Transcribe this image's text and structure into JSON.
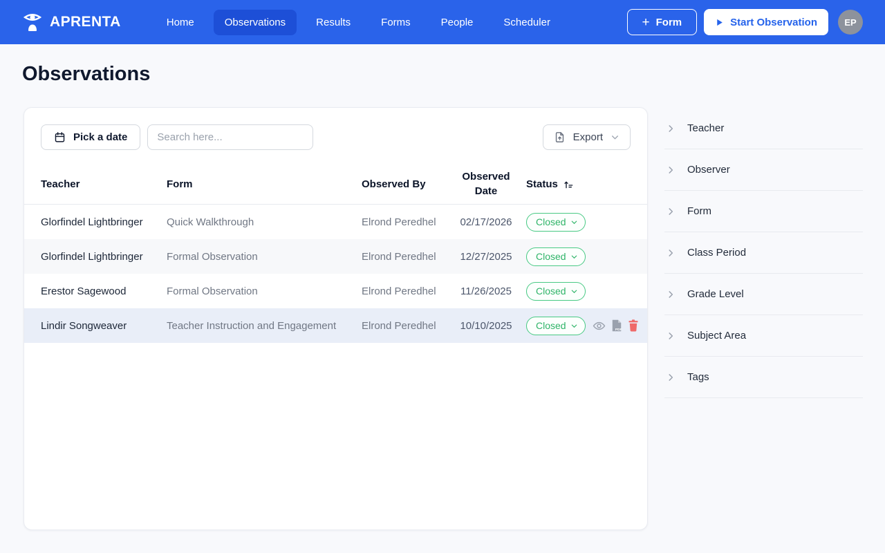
{
  "colors": {
    "navbar_blue": "#2a63ea",
    "nav_active_blue": "#1d4fd7",
    "accent_blue": "#2563eb",
    "badge_green_text": "#2fb468",
    "badge_green_border": "#47c983",
    "trash_red": "#ef6a6a",
    "row_highlight": "#e9eef8",
    "avatar_gray": "#8d929c"
  },
  "navbar": {
    "brand": "APRENTA",
    "items": [
      {
        "label": "Home",
        "active": false
      },
      {
        "label": "Observations",
        "active": true
      },
      {
        "label": "Results",
        "active": false
      },
      {
        "label": "Forms",
        "active": false
      },
      {
        "label": "People",
        "active": false
      },
      {
        "label": "Scheduler",
        "active": false
      }
    ],
    "form_button": {
      "plus": "+",
      "label": "Form"
    },
    "start_button": {
      "label": "Start Observation"
    },
    "avatar": {
      "initials": "EP"
    }
  },
  "page": {
    "title": "Observations"
  },
  "toolbar": {
    "pick_date_label": "Pick a date",
    "search_placeholder": "Search here...",
    "export_label": "Export"
  },
  "table": {
    "headers": {
      "teacher": "Teacher",
      "form": "Form",
      "observed_by": "Observed By",
      "observed_date": "Observed Date",
      "status": "Status"
    },
    "rows": [
      {
        "teacher": "Glorfindel Lightbringer",
        "form": "Quick Walkthrough",
        "observed_by": "Elrond Peredhel",
        "observed_date": "02/17/2026",
        "status": "Closed",
        "highlighted": false,
        "show_actions": false
      },
      {
        "teacher": "Glorfindel Lightbringer",
        "form": "Formal Observation",
        "observed_by": "Elrond Peredhel",
        "observed_date": "12/27/2025",
        "status": "Closed",
        "highlighted": false,
        "show_actions": false
      },
      {
        "teacher": "Erestor Sagewood",
        "form": "Formal Observation",
        "observed_by": "Elrond Peredhel",
        "observed_date": "11/26/2025",
        "status": "Closed",
        "highlighted": false,
        "show_actions": false
      },
      {
        "teacher": "Lindir Songweaver",
        "form": "Teacher Instruction and Engagement",
        "observed_by": "Elrond Peredhel",
        "observed_date": "10/10/2025",
        "status": "Closed",
        "highlighted": true,
        "show_actions": true
      }
    ],
    "row_action_icons": [
      "view",
      "export-pdf",
      "delete"
    ]
  },
  "filters": {
    "items": [
      "Teacher",
      "Observer",
      "Form",
      "Class Period",
      "Grade Level",
      "Subject Area",
      "Tags"
    ]
  }
}
